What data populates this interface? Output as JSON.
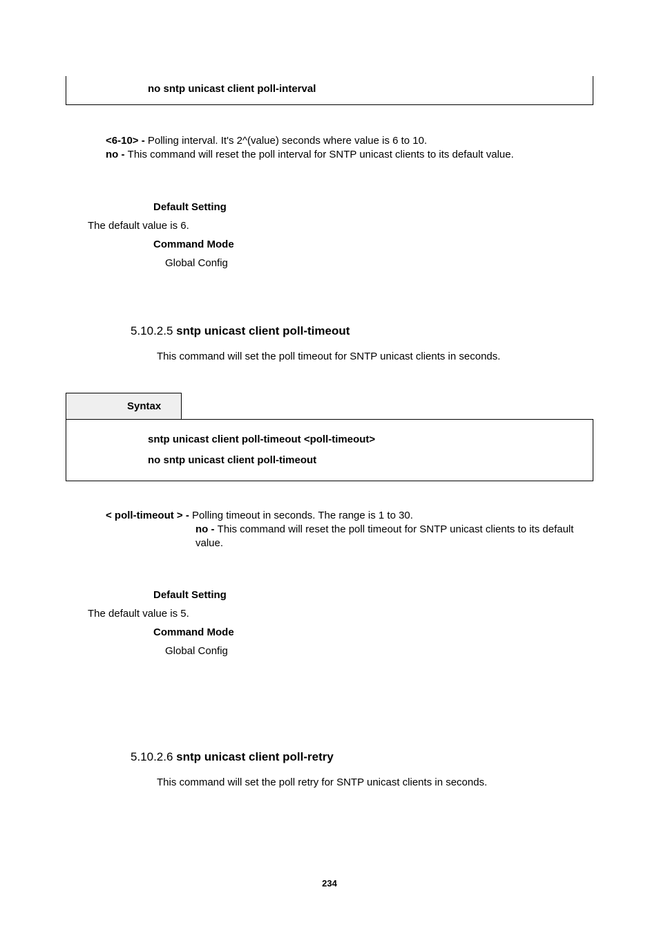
{
  "box_top": "no sntp unicast client poll-interval",
  "param1": {
    "key": "<6-10> - ",
    "desc": "Polling interval. It's 2^(value) seconds where value is 6 to 10."
  },
  "param2": {
    "key": "no - ",
    "desc": "This command will reset the poll interval for SNTP unicast clients to its default value."
  },
  "sec1": {
    "default_heading": "Default Setting",
    "default_text": "The default value is 6.",
    "cmd_heading": "Command Mode",
    "cmd_text": "Global Config"
  },
  "heading2_num": "5.10.2.5 ",
  "heading2_title": "sntp unicast client poll-timeout",
  "desc2": "This command will set the poll timeout for SNTP unicast clients in seconds.",
  "syntax_label": "Syntax",
  "syntax_lines": {
    "l1": "sntp unicast client poll-timeout <poll-timeout>",
    "l2": "no sntp unicast client poll-timeout"
  },
  "param3": {
    "key": "< poll-timeout > - ",
    "desc": "Polling timeout in seconds. The range is 1 to 30."
  },
  "param4": {
    "key": "no - ",
    "desc": "This command will reset the poll timeout for SNTP unicast clients to its default value."
  },
  "sec2": {
    "default_heading": "Default Setting",
    "default_text": "The default value is 5.",
    "cmd_heading": "Command Mode",
    "cmd_text": "Global Config"
  },
  "heading3_num": "5.10.2.6 ",
  "heading3_title": "sntp unicast client poll-retry",
  "desc3": "This command will set the poll retry for SNTP unicast clients in seconds.",
  "page_number": "234"
}
